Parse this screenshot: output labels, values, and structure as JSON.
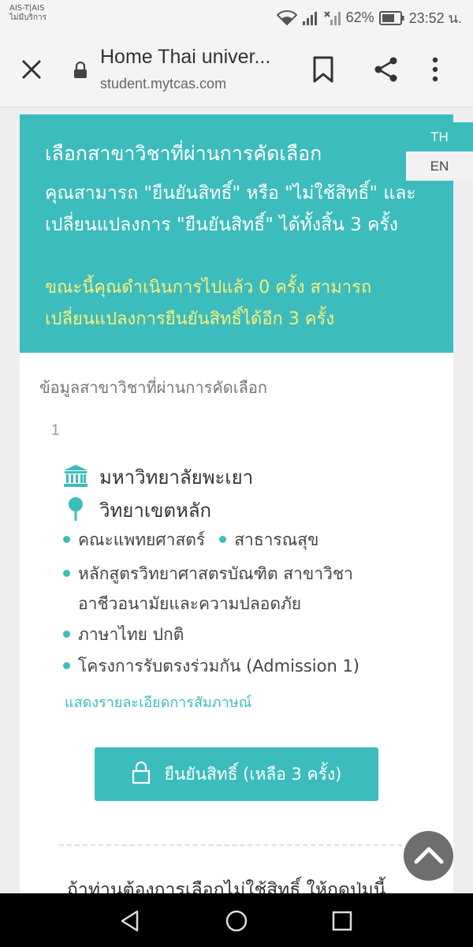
{
  "status_bar": {
    "carrier_line1": "AIS-T|AIS",
    "carrier_line2": "ไม่มีบริการ",
    "battery": "62%",
    "time": "23:52 น."
  },
  "browser": {
    "title": "Home Thai univer...",
    "url": "student.mytcas.com",
    "icons": [
      "close-icon",
      "lock-icon",
      "bookmark-icon",
      "share-icon",
      "more-vert-icon"
    ]
  },
  "banner": {
    "heading": "เลือกสาขาวิชาที่ผ่านการคัดเลือก",
    "info": "คุณสามารถ \"ยืนยันสิทธิ์\" หรือ \"ไม่ใช้สิทธิ์\" และเปลี่ยนแปลงการ \"ยืนยันสิทธิ์\" ได้ทั้งสิ้น 3 ครั้ง",
    "progress": "ขณะนี้คุณดำเนินการไปแล้ว 0 ครั้ง สามารถเปลี่ยนแปลงการยืนยันสิทธิ์ได้อีก 3 ครั้ง",
    "bg_color": "#3cbcbc",
    "highlight_color": "#f6f07a"
  },
  "lang": {
    "th": "TH",
    "en": "EN"
  },
  "section_label": "ข้อมูลสาขาวิชาที่ผ่านการคัดเลือก",
  "selection": {
    "number": "1",
    "university": "มหาวิทยาลัยพะเยา",
    "campus": "วิทยาเขตหลัก",
    "faculty": "คณะแพทยศาสตร์",
    "field": "สาธารณสุข",
    "program_line1": "หลักสูตรวิทยาศาสตรบัณฑิต สาขาวิชา",
    "program_line2": "อาชีวอนามัยและความปลอดภัย",
    "language": "ภาษาไทย ปกติ",
    "project": "โครงการรับตรงร่วมกัน (Admission 1)",
    "interview_link": "แสดงรายละเอียดการสัมภาษณ์",
    "confirm_button": "ยืนยันสิทธิ์ (เหลือ 3 ครั้ง)"
  },
  "reject_prompt": "ถ้าท่านต้องการเลือกไม่ใช้สิทธิ์ ให้กดปุ่มนี้",
  "nav": {
    "icons": [
      "back-icon",
      "home-icon",
      "recent-apps-icon"
    ]
  }
}
